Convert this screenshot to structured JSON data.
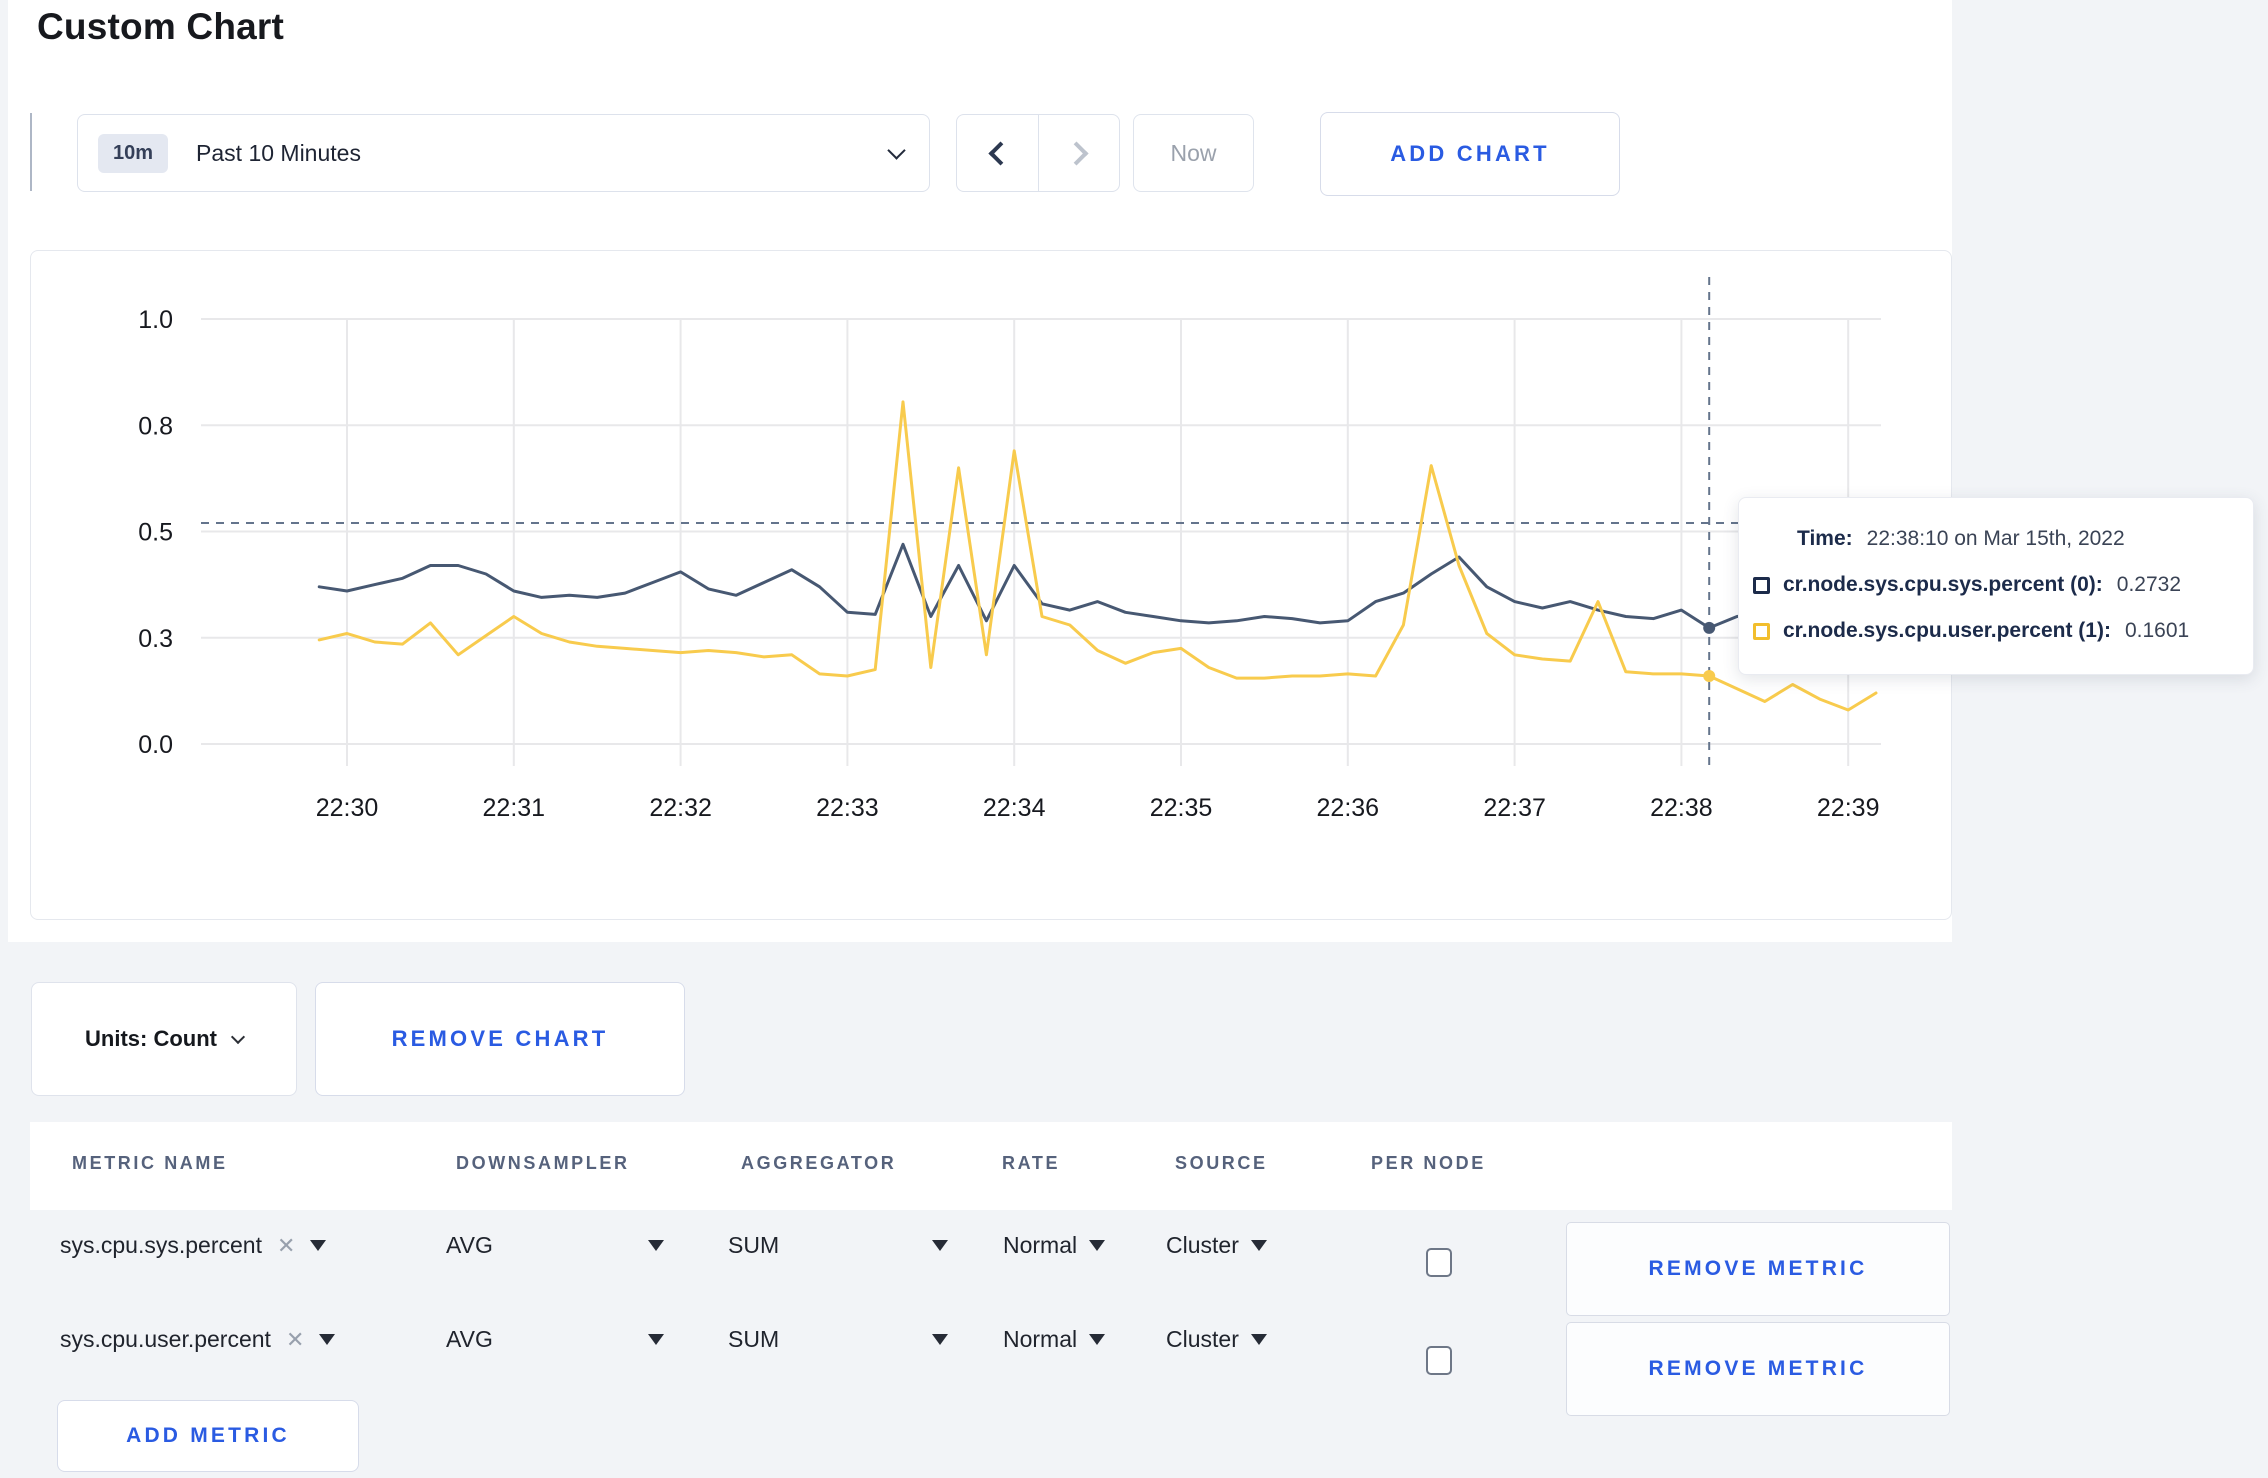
{
  "page": {
    "title": "Custom Chart"
  },
  "colors": {
    "accent_blue": "#2A5BE2",
    "series_sys": "#475872",
    "series_user": "#F8CB4D"
  },
  "toolbar": {
    "time_window_badge": "10m",
    "time_window_label": "Past 10 Minutes",
    "now_label": "Now",
    "add_chart_label": "ADD CHART"
  },
  "chart": {
    "tooltip": {
      "time_label": "Time:",
      "time_value": "22:38:10 on Mar 15th, 2022",
      "entries": [
        {
          "label": "cr.node.sys.cpu.sys.percent (0):",
          "value": "0.2732",
          "swatch_color": "#1C2B4A"
        },
        {
          "label": "cr.node.sys.cpu.user.percent (1):",
          "value": "0.1601",
          "swatch_color": "#F2BE2D"
        }
      ]
    }
  },
  "chart_data": {
    "type": "line",
    "title": "",
    "xlabel": "",
    "ylabel": "",
    "grid": true,
    "legend": "none",
    "x_axis": {
      "tick_labels": [
        "22:30",
        "22:31",
        "22:32",
        "22:33",
        "22:34",
        "22:35",
        "22:36",
        "22:37",
        "22:38",
        "22:39"
      ],
      "tick_offsets_sec": [
        0,
        60,
        120,
        180,
        240,
        300,
        360,
        420,
        480,
        540
      ]
    },
    "y_axis": {
      "ylim": [
        0,
        1
      ],
      "tick_values": [
        0,
        0.25,
        0.5,
        0.75,
        1.0
      ],
      "tick_labels": [
        "0.0",
        "0.3",
        "0.5",
        "0.8",
        "1.0"
      ]
    },
    "x_offsets_sec": [
      -10,
      0,
      10,
      20,
      30,
      40,
      50,
      60,
      70,
      80,
      90,
      100,
      110,
      120,
      130,
      140,
      150,
      160,
      170,
      180,
      190,
      200,
      210,
      220,
      230,
      240,
      250,
      260,
      270,
      280,
      290,
      300,
      310,
      320,
      330,
      340,
      350,
      360,
      370,
      380,
      390,
      400,
      410,
      420,
      430,
      440,
      450,
      460,
      470,
      480,
      490,
      500,
      510,
      520,
      530,
      540,
      550
    ],
    "series": [
      {
        "name": "cr.node.sys.cpu.sys.percent",
        "color": "#475872",
        "values": [
          0.37,
          0.36,
          0.375,
          0.39,
          0.42,
          0.42,
          0.4,
          0.36,
          0.345,
          0.35,
          0.345,
          0.355,
          0.38,
          0.405,
          0.365,
          0.35,
          0.38,
          0.41,
          0.37,
          0.31,
          0.305,
          0.47,
          0.3,
          0.42,
          0.29,
          0.42,
          0.33,
          0.315,
          0.335,
          0.31,
          0.3,
          0.29,
          0.285,
          0.29,
          0.3,
          0.295,
          0.285,
          0.29,
          0.335,
          0.355,
          0.4,
          0.44,
          0.37,
          0.335,
          0.32,
          0.335,
          0.315,
          0.3,
          0.295,
          0.315,
          0.2732,
          0.3,
          0.31,
          0.305,
          0.3,
          0.305,
          0.31
        ]
      },
      {
        "name": "cr.node.sys.cpu.user.percent",
        "color": "#F8CB4D",
        "values": [
          0.245,
          0.26,
          0.24,
          0.235,
          0.285,
          0.21,
          0.255,
          0.3,
          0.26,
          0.24,
          0.23,
          0.225,
          0.22,
          0.215,
          0.22,
          0.215,
          0.205,
          0.21,
          0.165,
          0.16,
          0.175,
          0.805,
          0.18,
          0.65,
          0.21,
          0.69,
          0.3,
          0.28,
          0.22,
          0.19,
          0.215,
          0.225,
          0.18,
          0.155,
          0.155,
          0.16,
          0.16,
          0.165,
          0.16,
          0.28,
          0.655,
          0.42,
          0.26,
          0.21,
          0.2,
          0.195,
          0.335,
          0.17,
          0.165,
          0.165,
          0.1601,
          0.13,
          0.1,
          0.14,
          0.105,
          0.08,
          0.12
        ]
      }
    ],
    "crosshair": {
      "x_offset_sec": 490,
      "hline_value": 0.52
    }
  },
  "controls": {
    "units_label": "Units: Count",
    "remove_chart_label": "REMOVE CHART",
    "add_metric_label": "ADD METRIC"
  },
  "table": {
    "headers": [
      "METRIC NAME",
      "DOWNSAMPLER",
      "AGGREGATOR",
      "RATE",
      "SOURCE",
      "PER NODE"
    ],
    "remove_metric_label": "REMOVE METRIC",
    "rows": [
      {
        "metric": "sys.cpu.sys.percent",
        "downsampler": "AVG",
        "aggregator": "SUM",
        "rate": "Normal",
        "source": "Cluster",
        "per_node_checked": false
      },
      {
        "metric": "sys.cpu.user.percent",
        "downsampler": "AVG",
        "aggregator": "SUM",
        "rate": "Normal",
        "source": "Cluster",
        "per_node_checked": false
      }
    ]
  }
}
